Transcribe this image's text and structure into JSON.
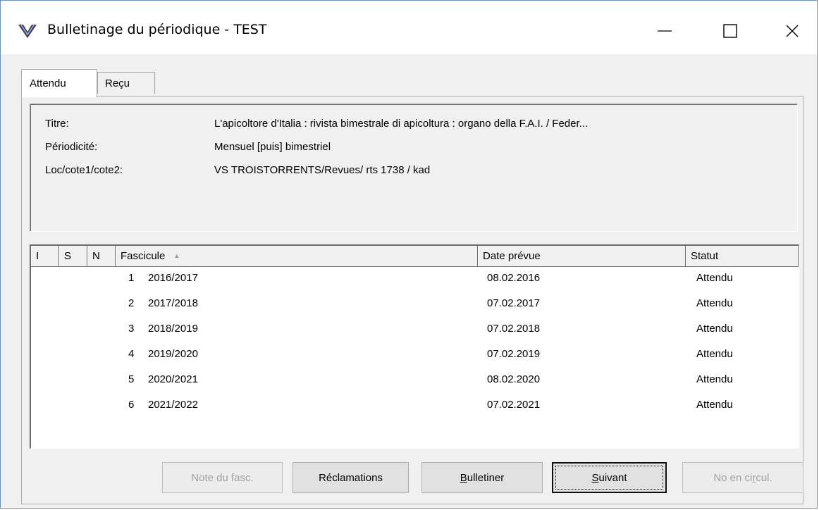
{
  "window": {
    "title": "Bulletinage du périodique - TEST"
  },
  "tabs": [
    {
      "label": "Attendu",
      "active": true
    },
    {
      "label": "Reçu",
      "active": false
    }
  ],
  "info": {
    "titre_label": "Titre:",
    "titre_value": "L'apicoltore d'Italia : rivista bimestrale di apicoltura : organo della F.A.I. / Feder...",
    "periodicite_label": "Périodicité:",
    "periodicite_value": "Mensuel [puis] bimestriel",
    "loc_label": "Loc/cote1/cote2:",
    "loc_value": "VS TROISTORRENTS/Revues/ rts 1738 / kad"
  },
  "table": {
    "columns": [
      "I",
      "S",
      "N",
      "Fascicule",
      "Date prévue",
      "Statut"
    ],
    "sort_indicator": "▲",
    "rows": [
      {
        "num": "1",
        "fascicule": "2016/2017",
        "date": "08.02.2016",
        "statut": "Attendu"
      },
      {
        "num": "2",
        "fascicule": "2017/2018",
        "date": "07.02.2017",
        "statut": "Attendu"
      },
      {
        "num": "3",
        "fascicule": "2018/2019",
        "date": "07.02.2018",
        "statut": "Attendu"
      },
      {
        "num": "4",
        "fascicule": "2019/2020",
        "date": "07.02.2019",
        "statut": "Attendu"
      },
      {
        "num": "5",
        "fascicule": "2020/2021",
        "date": "08.02.2020",
        "statut": "Attendu"
      },
      {
        "num": "6",
        "fascicule": "2021/2022",
        "date": "07.02.2021",
        "statut": "Attendu"
      }
    ]
  },
  "buttons": {
    "note": "Note du fasc.",
    "reclamations": "Réclamations",
    "bulletiner_mnemonic": "B",
    "bulletiner_rest": "ulletiner",
    "suivant_mnemonic": "S",
    "suivant_rest": "uivant",
    "circul_pre": "No en ci",
    "circul_mnemonic": "r",
    "circul_post": "cul."
  },
  "colors": {
    "window_bg": "#f0f0f0",
    "titlebar_bg": "#ffffff",
    "border_accent": "#6b8fc7",
    "disabled_text": "#a0a0a0"
  }
}
